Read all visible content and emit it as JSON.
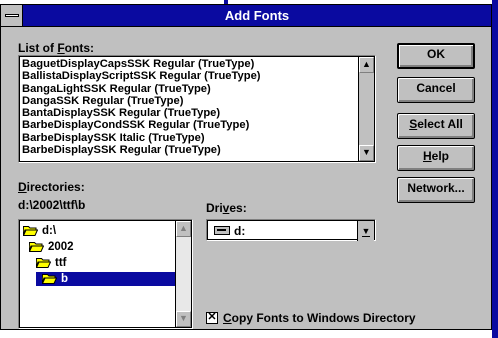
{
  "window": {
    "title": "Add Fonts"
  },
  "font_list": {
    "label_prefix": "List of ",
    "label_accel": "F",
    "label_suffix": "onts:",
    "items": [
      "BaguetDisplayCapsSSK Regular (TrueType)",
      "BallistaDisplayScriptSSK Regular (TrueType)",
      "BangaLightSSK Regular (TrueType)",
      "DangaSSK Regular (TrueType)",
      "BantaDisplaySSK Regular (TrueType)",
      "BarbeDisplayCondSSK Regular (TrueType)",
      "BarbeDisplaySSK Italic (TrueType)",
      "BarbeDisplaySSK Regular (TrueType)"
    ],
    "scroll_up_glyph": "▲",
    "scroll_down_glyph": "▼"
  },
  "buttons": {
    "ok": "OK",
    "cancel": "Cancel",
    "select_all_accel": "S",
    "select_all_rest": "elect All",
    "help_accel": "H",
    "help_rest": "elp",
    "network": "Network..."
  },
  "directories": {
    "label_accel": "D",
    "label_rest": "irectories:",
    "current_path": "d:\\2002\\ttf\\b",
    "tree": [
      "d:\\",
      "2002",
      "ttf",
      "b"
    ],
    "selected": "b"
  },
  "drives": {
    "label_prefix": "Dri",
    "label_accel": "v",
    "label_suffix": "es:",
    "selected": "d:",
    "drive_icon": "drive-icon",
    "dropdown_glyph": "▼"
  },
  "copy_option": {
    "checked": true,
    "check_mark": "✕",
    "label_accel": "C",
    "label_rest": "opy Fonts to Windows Directory"
  }
}
